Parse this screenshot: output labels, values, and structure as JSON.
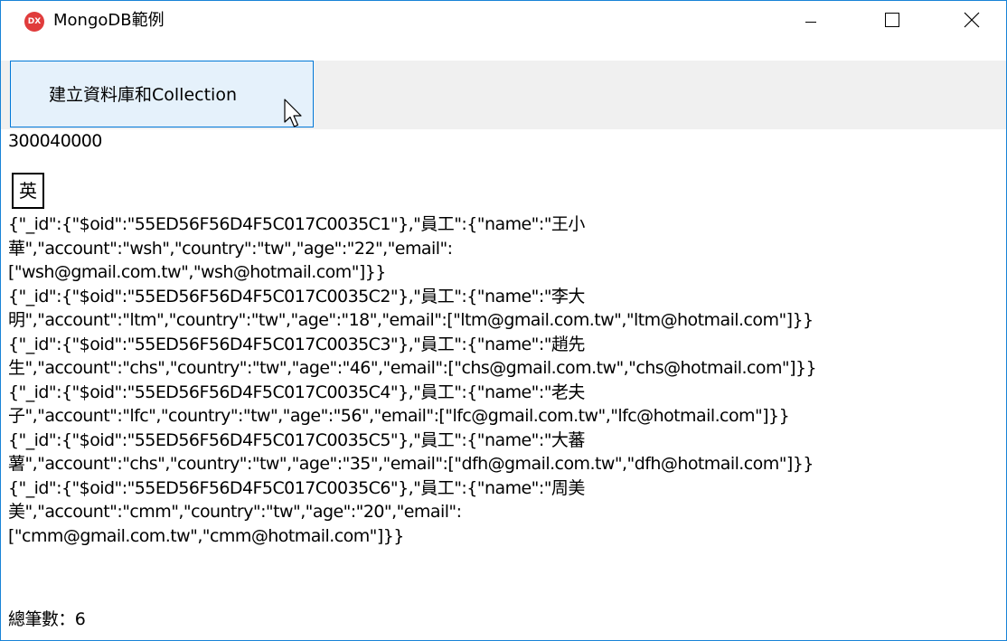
{
  "window": {
    "title": "MongoDB範例",
    "app_icon_text": "DX",
    "app_icon_color": "#e03c3c",
    "border_color": "#1883d7",
    "controls": [
      "minimize-icon",
      "maximize-icon",
      "close-icon"
    ]
  },
  "toolbar": {
    "create_button_label": "建立資料庫和Collection"
  },
  "output": {
    "first_line": "300040000",
    "ime_indicator": "英",
    "record_lines": [
      "{\"_id\":{\"$oid\":\"55ED56F56D4F5C017C0035C1\"},\"員工\":{\"name\":\"王小",
      "華\",\"account\":\"wsh\",\"country\":\"tw\",\"age\":\"22\",\"email\":",
      "[\"wsh@gmail.com.tw\",\"wsh@hotmail.com\"]}}",
      "{\"_id\":{\"$oid\":\"55ED56F56D4F5C017C0035C2\"},\"員工\":{\"name\":\"李大",
      "明\",\"account\":\"ltm\",\"country\":\"tw\",\"age\":\"18\",\"email\":[\"ltm@gmail.com.tw\",\"ltm@hotmail.com\"]}}",
      "{\"_id\":{\"$oid\":\"55ED56F56D4F5C017C0035C3\"},\"員工\":{\"name\":\"趙先",
      "生\",\"account\":\"chs\",\"country\":\"tw\",\"age\":\"46\",\"email\":[\"chs@gmail.com.tw\",\"chs@hotmail.com\"]}}",
      "{\"_id\":{\"$oid\":\"55ED56F56D4F5C017C0035C4\"},\"員工\":{\"name\":\"老夫",
      "子\",\"account\":\"lfc\",\"country\":\"tw\",\"age\":\"56\",\"email\":[\"lfc@gmail.com.tw\",\"lfc@hotmail.com\"]}}",
      "{\"_id\":{\"$oid\":\"55ED56F56D4F5C017C0035C5\"},\"員工\":{\"name\":\"大蕃",
      "薯\",\"account\":\"chs\",\"country\":\"tw\",\"age\":\"35\",\"email\":[\"dfh@gmail.com.tw\",\"dfh@hotmail.com\"]}}",
      "{\"_id\":{\"$oid\":\"55ED56F56D4F5C017C0035C6\"},\"員工\":{\"name\":\"周美",
      "美\",\"account\":\"cmm\",\"country\":\"tw\",\"age\":\"20\",\"email\":",
      "[\"cmm@gmail.com.tw\",\"cmm@hotmail.com\"]}}"
    ],
    "total_line": "總筆數：6"
  }
}
